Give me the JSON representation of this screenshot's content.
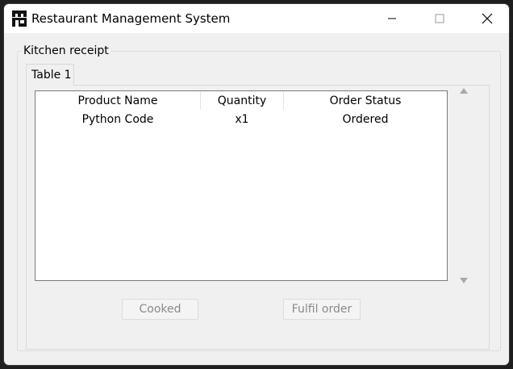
{
  "window": {
    "title": "Restaurant Management System",
    "icon": "store-icon"
  },
  "kitchen": {
    "group_label": "Kitchen receipt",
    "tab_label": "Table 1",
    "columns": [
      "Product Name",
      "Quantity",
      "Order Status"
    ],
    "rows": [
      [
        "Python Code",
        "x1",
        "Ordered"
      ]
    ],
    "cooked_label": "Cooked",
    "fulfil_label": "Fulfil order"
  },
  "colors": {
    "window_bg": "#f0f0f0",
    "titlebar_bg": "#ffffff",
    "desktop_bg": "#1e1e1e",
    "disabled_text": "#8a8a8a"
  }
}
